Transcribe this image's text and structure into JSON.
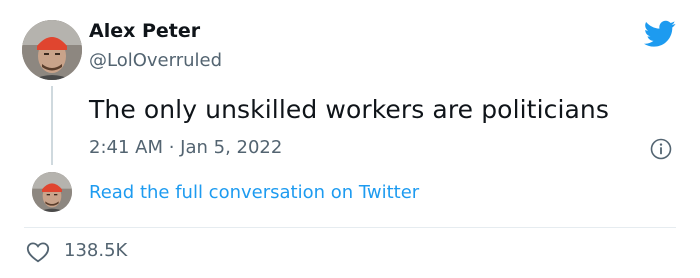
{
  "author": {
    "name": "Alex Peter",
    "handle": "@LolOverruled"
  },
  "tweet": {
    "text": "The only unskilled workers are politicians",
    "timestamp": "2:41 AM · Jan 5, 2022"
  },
  "conversation_link": "Read the full conversation on Twitter",
  "engagement": {
    "likes": "138.5K"
  },
  "icons": {
    "brand": "twitter-bird-icon",
    "info": "info-icon",
    "like": "heart-icon"
  },
  "colors": {
    "brand": "#1d9bf0",
    "text": "#0f1419",
    "secondary": "#536471"
  }
}
